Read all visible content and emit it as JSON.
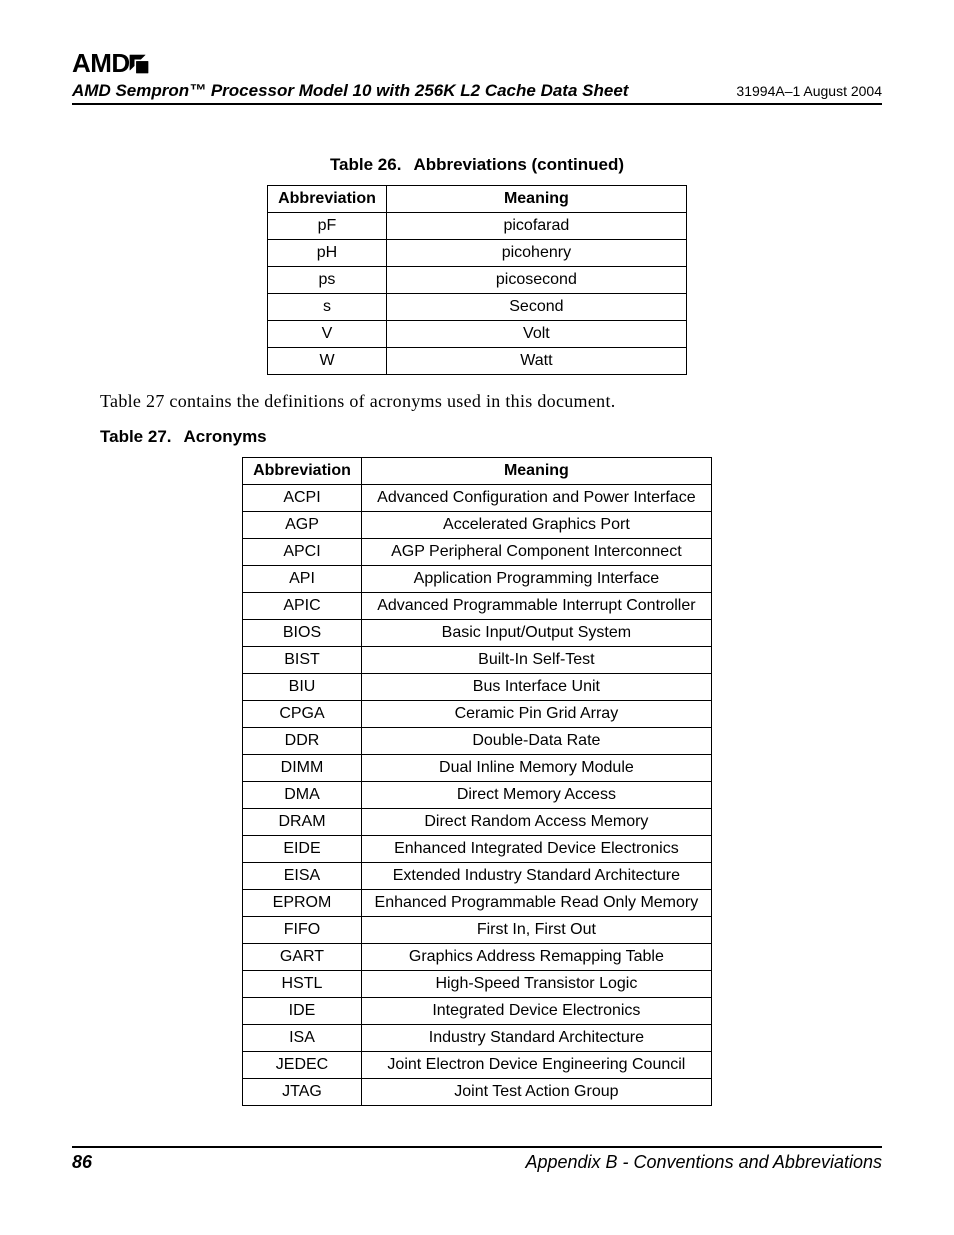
{
  "header": {
    "logo": "AMD",
    "doc_title": "AMD Sempron™ Processor Model 10 with 256K L2 Cache Data Sheet",
    "doc_rev": "31994A–1 August 2004"
  },
  "table26": {
    "caption_num": "Table 26.",
    "caption_text": "Abbreviations (continued)",
    "head_abbr": "Abbreviation",
    "head_mean": "Meaning",
    "rows": [
      {
        "abbr": "pF",
        "mean": "picofarad"
      },
      {
        "abbr": "pH",
        "mean": "picohenry"
      },
      {
        "abbr": "ps",
        "mean": "picosecond"
      },
      {
        "abbr": "s",
        "mean": "Second"
      },
      {
        "abbr": "V",
        "mean": "Volt"
      },
      {
        "abbr": "W",
        "mean": "Watt"
      }
    ]
  },
  "body_text": "Table 27 contains the definitions of acronyms used in this document.",
  "table27": {
    "caption_num": "Table 27.",
    "caption_text": "Acronyms",
    "head_abbr": "Abbreviation",
    "head_mean": "Meaning",
    "rows": [
      {
        "abbr": "ACPI",
        "mean": "Advanced Configuration and Power Interface"
      },
      {
        "abbr": "AGP",
        "mean": "Accelerated Graphics Port"
      },
      {
        "abbr": "APCI",
        "mean": "AGP Peripheral Component Interconnect"
      },
      {
        "abbr": "API",
        "mean": "Application Programming Interface"
      },
      {
        "abbr": "APIC",
        "mean": "Advanced Programmable Interrupt Controller"
      },
      {
        "abbr": "BIOS",
        "mean": "Basic Input/Output System"
      },
      {
        "abbr": "BIST",
        "mean": "Built-In Self-Test"
      },
      {
        "abbr": "BIU",
        "mean": "Bus Interface Unit"
      },
      {
        "abbr": "CPGA",
        "mean": "Ceramic Pin Grid Array"
      },
      {
        "abbr": "DDR",
        "mean": "Double-Data Rate"
      },
      {
        "abbr": "DIMM",
        "mean": "Dual Inline Memory Module"
      },
      {
        "abbr": "DMA",
        "mean": "Direct Memory Access"
      },
      {
        "abbr": "DRAM",
        "mean": "Direct Random Access Memory"
      },
      {
        "abbr": "EIDE",
        "mean": "Enhanced Integrated Device Electronics"
      },
      {
        "abbr": "EISA",
        "mean": "Extended Industry Standard Architecture"
      },
      {
        "abbr": "EPROM",
        "mean": "Enhanced Programmable Read Only Memory"
      },
      {
        "abbr": "FIFO",
        "mean": "First In, First Out"
      },
      {
        "abbr": "GART",
        "mean": "Graphics Address Remapping Table"
      },
      {
        "abbr": "HSTL",
        "mean": "High-Speed Transistor Logic"
      },
      {
        "abbr": "IDE",
        "mean": "Integrated Device Electronics"
      },
      {
        "abbr": "ISA",
        "mean": "Industry Standard Architecture"
      },
      {
        "abbr": "JEDEC",
        "mean": "Joint Electron Device Engineering Council"
      },
      {
        "abbr": "JTAG",
        "mean": "Joint Test Action Group"
      }
    ]
  },
  "footer": {
    "page_num": "86",
    "appendix": "Appendix B - Conventions and Abbreviations"
  }
}
